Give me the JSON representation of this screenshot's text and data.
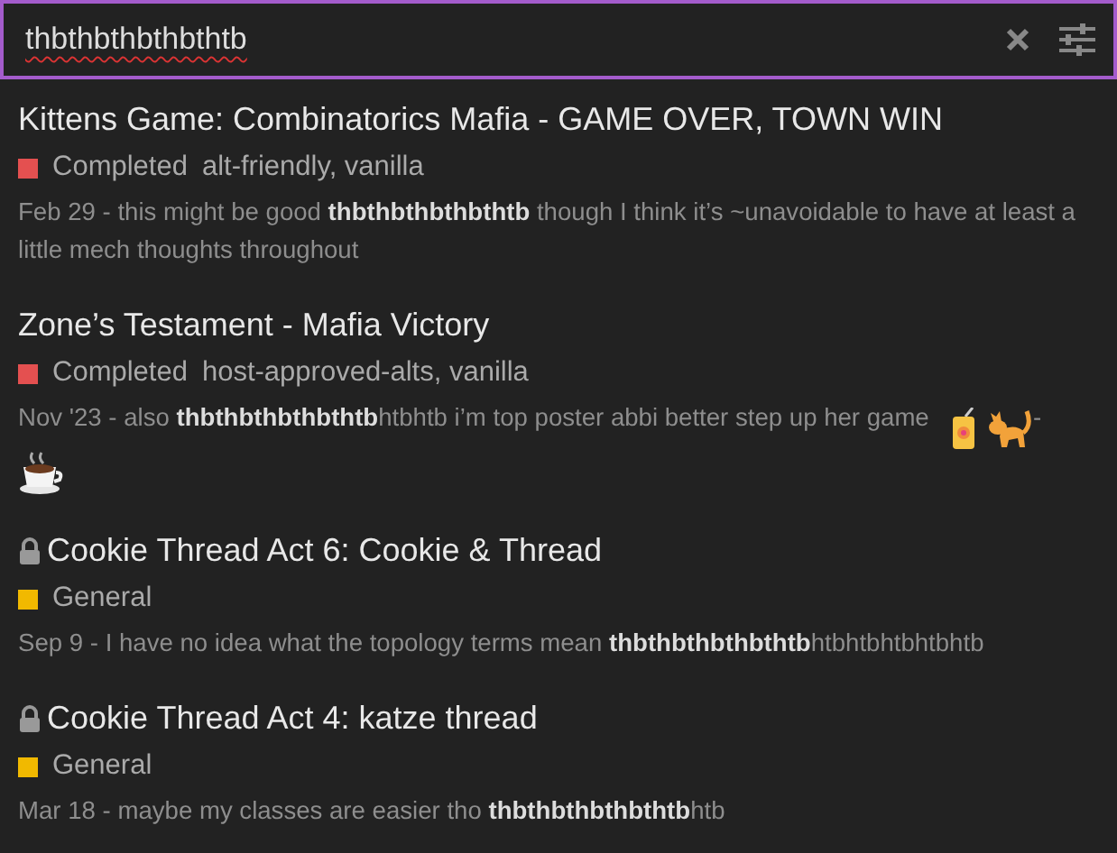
{
  "search": {
    "value": "thbthbthbthbthtb"
  },
  "results": [
    {
      "title": "Kittens Game: Combinatorics Mafia - GAME OVER, TOWN WIN",
      "locked": false,
      "category": "Completed",
      "color": "#e45050",
      "tags": "alt-friendly, vanilla",
      "snippet": "Feb 29 - this might be good **thbthbthbthbthtb** though I think it’s ~unavoidable to have at least a little mech thoughts throughout"
    },
    {
      "title": "Zone’s Testament - Mafia Victory",
      "locked": false,
      "category": "Completed",
      "color": "#e45050",
      "tags": "host-approved-alts, vanilla",
      "snippet": "Nov '23 - also **thbthbthbthbthtb**htbhtb i’m top poster abbi better step up her game",
      "snippet_tail": "-"
    },
    {
      "title": "Cookie Thread Act 6: Cookie & Thread",
      "locked": true,
      "category": "General",
      "color": "#f1b900",
      "snippet": "Sep 9 - I have no idea what the topology terms mean **thbthbthbthbthtb**htbhtbhtbhtbhtb"
    },
    {
      "title": "Cookie Thread Act 4: katze thread",
      "locked": true,
      "category": "General",
      "color": "#f1b900",
      "snippet": "Mar 18 - maybe my classes are easier tho **thbthbthbthbthtb**htb"
    }
  ]
}
